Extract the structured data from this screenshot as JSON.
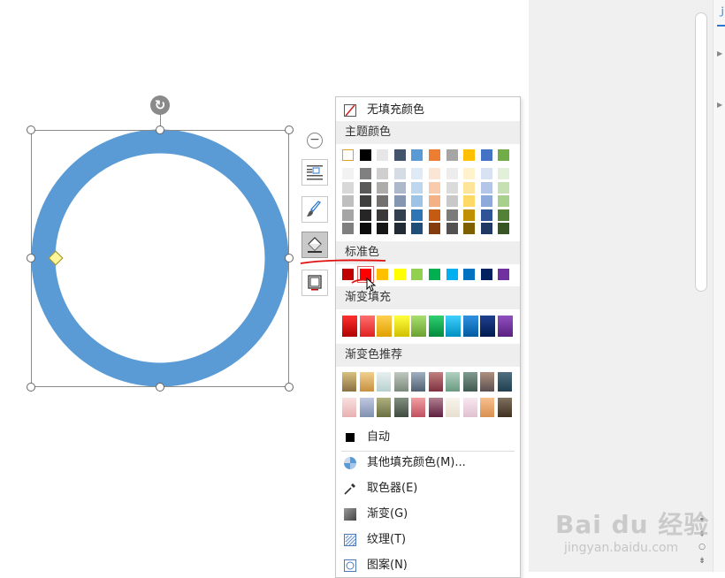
{
  "canvas": {
    "shape": {
      "kind": "ring",
      "stroke_color": "#5b9bd5",
      "fill": "none"
    }
  },
  "floating_toolbar": {
    "buttons": [
      {
        "name": "collapse",
        "icon": "minus-circle-icon"
      },
      {
        "name": "text-wrap",
        "icon": "wrap-text-icon"
      },
      {
        "name": "outline",
        "icon": "brush-icon"
      },
      {
        "name": "fill",
        "icon": "paint-bucket-icon",
        "active": true
      },
      {
        "name": "shape-effects",
        "icon": "square-frame-icon"
      }
    ]
  },
  "fill_menu": {
    "no_fill_label": "无填充颜色",
    "theme_colors_label": "主题颜色",
    "theme_top_row": [
      "#ffffff",
      "#000000",
      "#e7e6e6",
      "#44546a",
      "#5b9bd5",
      "#ed7d31",
      "#a5a5a5",
      "#ffc000",
      "#4472c4",
      "#70ad47"
    ],
    "theme_shades": [
      [
        "#f2f2f2",
        "#808080",
        "#d0cece",
        "#d6dce4",
        "#deebf6",
        "#fbe5d5",
        "#ededed",
        "#fff2cc",
        "#d9e2f3",
        "#e2efd9"
      ],
      [
        "#d8d8d8",
        "#595959",
        "#aeabab",
        "#adb9ca",
        "#bdd7ee",
        "#f7cbac",
        "#dbdbdb",
        "#fee599",
        "#b4c6e7",
        "#c5e0b3"
      ],
      [
        "#bfbfbf",
        "#3f3f3f",
        "#757070",
        "#8496b0",
        "#9dc3e6",
        "#f4b183",
        "#c9c9c9",
        "#ffd965",
        "#8eaadb",
        "#a8d08d"
      ],
      [
        "#a5a5a5",
        "#262626",
        "#3a3838",
        "#323f4f",
        "#2e75b5",
        "#c55a11",
        "#7b7b7b",
        "#bf9000",
        "#2f5496",
        "#538135"
      ],
      [
        "#7f7f7f",
        "#0c0c0c",
        "#171616",
        "#222a35",
        "#1f4e79",
        "#843c0c",
        "#525252",
        "#7f6000",
        "#1f3864",
        "#375623"
      ]
    ],
    "standard_colors_label": "标准色",
    "standard_colors": [
      "#c00000",
      "#ff0000",
      "#ffc000",
      "#ffff00",
      "#92d050",
      "#00b050",
      "#00b0f0",
      "#0070c0",
      "#002060",
      "#7030a0"
    ],
    "selected_standard_index": 1,
    "gradient_fill_label": "渐变填充",
    "gradient_fill": [
      [
        "#b00000",
        "#ff3030"
      ],
      [
        "#e02020",
        "#ff7070"
      ],
      [
        "#e0a000",
        "#ffd050"
      ],
      [
        "#d0c000",
        "#ffff40"
      ],
      [
        "#6aa030",
        "#a8e070"
      ],
      [
        "#008a3c",
        "#30d070"
      ],
      [
        "#0090c0",
        "#40d0ff"
      ],
      [
        "#005aa0",
        "#3090e0"
      ],
      [
        "#001a50",
        "#204090"
      ],
      [
        "#5a2080",
        "#9050c0"
      ]
    ],
    "gradient_recommend_label": "渐变色推荐",
    "gradient_recommend": [
      [
        [
          "#8a7040",
          "#d8c080"
        ],
        [
          "#c89040",
          "#f0d090"
        ],
        [
          "#b8d0d0",
          "#e8f0f0"
        ],
        [
          "#7a8a7a",
          "#c0c8c0"
        ],
        [
          "#506070",
          "#a0b0c0"
        ],
        [
          "#803040",
          "#c08080"
        ],
        [
          "#6a9a80",
          "#b0d0c0"
        ],
        [
          "#405a50",
          "#809a90"
        ],
        [
          "#5a5050",
          "#b09080"
        ],
        [
          "#204050",
          "#507080"
        ]
      ],
      [
        [
          "#e8b0b0",
          "#f8e0e0"
        ],
        [
          "#8090b0",
          "#c0c8e0"
        ],
        [
          "#6a7040",
          "#b0b080"
        ],
        [
          "#404a40",
          "#809080"
        ],
        [
          "#c05060",
          "#f0a0a0"
        ],
        [
          "#602040",
          "#b08090"
        ],
        [
          "#e8e0d0",
          "#f8f4ec"
        ],
        [
          "#e0c0d0",
          "#f8e8f0"
        ],
        [
          "#d89050",
          "#f8c090"
        ],
        [
          "#403020",
          "#807060"
        ]
      ]
    ],
    "auto_label": "自动",
    "more_colors_label": "其他填充颜色(M)...",
    "eyedropper_label": "取色器(E)",
    "gradient_label": "渐变(G)",
    "texture_label": "纹理(T)",
    "pattern_label": "图案(N)"
  },
  "watermark": {
    "brand": "Bai du 经验",
    "url": "jingyan.baidu.com"
  },
  "side_panel": {
    "tab_glyph": "ｊ"
  }
}
